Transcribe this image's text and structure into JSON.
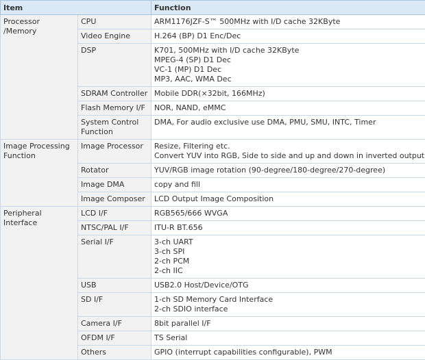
{
  "header": {
    "item": "Item",
    "function": "Function"
  },
  "groups": [
    {
      "name": "Processor /Memory",
      "rows": [
        {
          "sub": "CPU",
          "lines": [
            "ARM1176JZF-S™ 500MHz with I/D cache 32KByte"
          ]
        },
        {
          "sub": "Video Engine",
          "lines": [
            "H.264 (BP) D1 Enc/Dec"
          ]
        },
        {
          "sub": "DSP",
          "lines": [
            "K701, 500MHz with I/D cache 32KByte",
            "MPEG-4 (SP) D1 Dec",
            "VC-1 (MP) D1 Dec",
            "MP3, AAC, WMA Dec"
          ]
        },
        {
          "sub": "SDRAM Controller",
          "lines": [
            "Mobile DDR(×32bit, 166MHz)"
          ]
        },
        {
          "sub": "Flash Memory I/F",
          "lines": [
            "NOR, NAND, eMMC"
          ]
        },
        {
          "sub": "System Control Function",
          "lines": [
            "DMA, For audio exclusive use DMA, PMU, SMU, INTC, Timer"
          ]
        }
      ]
    },
    {
      "name": "Image Processing Function",
      "rows": [
        {
          "sub": "Image Processor",
          "lines": [
            "Resize, Filtering etc.",
            "Convert YUV into RGB, Side to side and up and down in inverted output"
          ]
        },
        {
          "sub": "Rotator",
          "lines": [
            "YUV/RGB image rotation (90-degree/180-degree/270-degree)"
          ]
        },
        {
          "sub": "Image DMA",
          "lines": [
            "copy and fill"
          ]
        },
        {
          "sub": "Image Composer",
          "lines": [
            "LCD Output Image Composition"
          ]
        }
      ]
    },
    {
      "name": "Peripheral Interface",
      "rows": [
        {
          "sub": "LCD I/F",
          "lines": [
            "RGB565/666 WVGA"
          ]
        },
        {
          "sub": "NTSC/PAL I/F",
          "lines": [
            "ITU-R BT.656"
          ]
        },
        {
          "sub": "Serial I/F",
          "lines": [
            "3-ch UART",
            "3-ch SPI",
            "2-ch PCM",
            "2-ch IIC"
          ]
        },
        {
          "sub": "USB",
          "lines": [
            "USB2.0 Host/Device/OTG"
          ]
        },
        {
          "sub": "SD I/F",
          "lines": [
            "1-ch SD Memory Card Interface",
            "2-ch SDIO interface"
          ]
        },
        {
          "sub": "Camera I/F",
          "lines": [
            "8bit parallel I/F"
          ]
        },
        {
          "sub": "OFDM I/F",
          "lines": [
            "TS Serial"
          ]
        },
        {
          "sub": "Others",
          "lines": [
            "GPIO (interrupt capabilities configurable), PWM"
          ]
        }
      ]
    }
  ]
}
